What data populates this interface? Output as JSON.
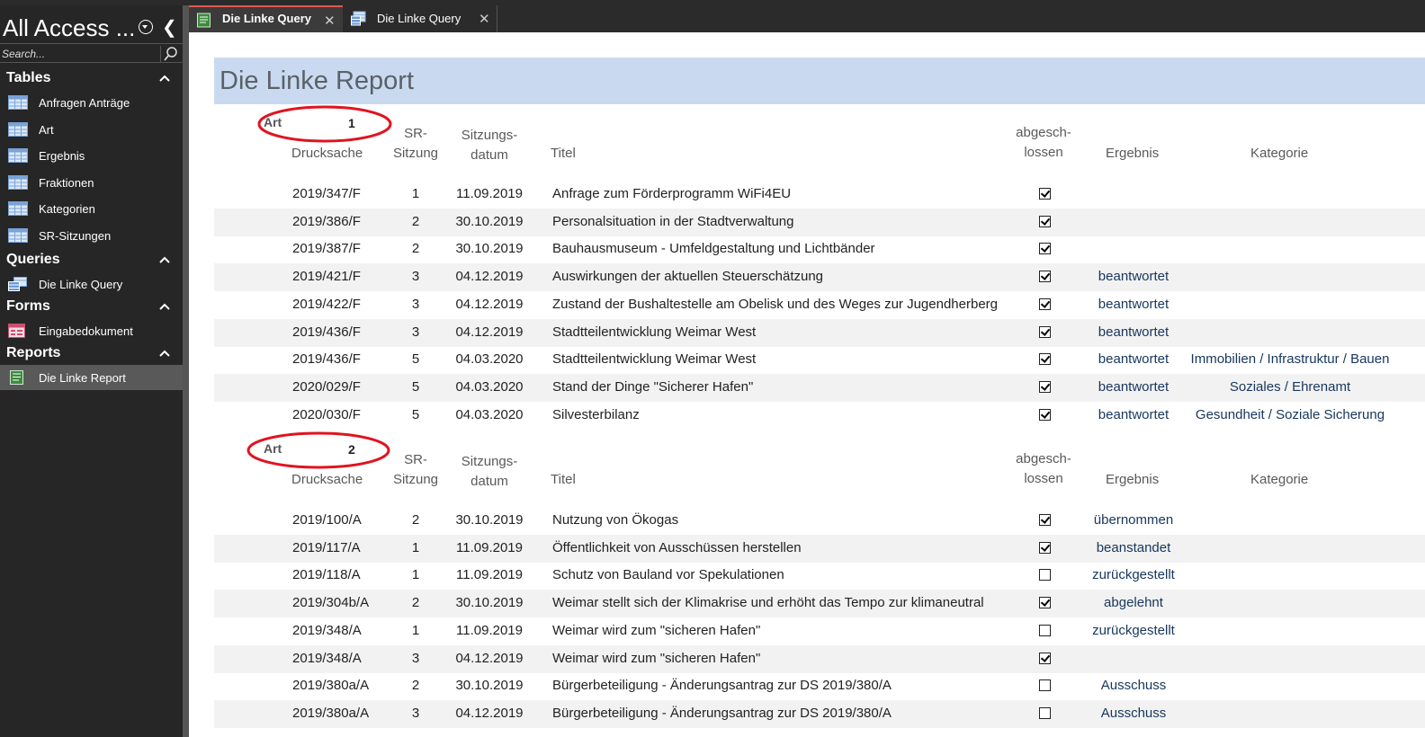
{
  "nav": {
    "title": "All Access ...",
    "search_placeholder": "Search...",
    "groups": [
      {
        "label": "Tables",
        "items": [
          "Anfragen Anträge",
          "Art",
          "Ergebnis",
          "Fraktionen",
          "Kategorien",
          "SR-Sitzungen"
        ]
      },
      {
        "label": "Queries",
        "items": [
          "Die Linke Query"
        ]
      },
      {
        "label": "Forms",
        "items": [
          "Eingabedokument"
        ]
      },
      {
        "label": "Reports",
        "items": [
          "Die Linke Report"
        ]
      }
    ],
    "selected_item": "Die Linke Report"
  },
  "tabs": [
    {
      "label": "Die Linke Query",
      "active": true,
      "icon": "report-icon"
    },
    {
      "label": "Die Linke Query",
      "active": false,
      "icon": "query-icon"
    }
  ],
  "report": {
    "title": "Die Linke Report",
    "columns": {
      "drucksache": "Drucksache",
      "sr_sitzung": [
        "SR-",
        "Sitzung"
      ],
      "sitzungsdatum": [
        "Sitzungs-",
        "datum"
      ],
      "titel": "Titel",
      "abgeschlossen": [
        "abgesch-",
        "lossen"
      ],
      "ergebnis": "Ergebnis",
      "kategorie": "Kategorie"
    },
    "groups": [
      {
        "label": "Art",
        "value": "1",
        "rows": [
          {
            "drucksache": "2019/347/F",
            "sitzung": "1",
            "datum": "11.09.2019",
            "titel": "Anfrage zum Förderprogramm WiFi4EU",
            "abgeschlossen": true,
            "ergebnis": "",
            "kategorie": ""
          },
          {
            "drucksache": "2019/386/F",
            "sitzung": "2",
            "datum": "30.10.2019",
            "titel": "Personalsituation in der Stadtverwaltung",
            "abgeschlossen": true,
            "ergebnis": "",
            "kategorie": ""
          },
          {
            "drucksache": "2019/387/F",
            "sitzung": "2",
            "datum": "30.10.2019",
            "titel": "Bauhausmuseum - Umfeldgestaltung und Lichtbänder",
            "abgeschlossen": true,
            "ergebnis": "",
            "kategorie": ""
          },
          {
            "drucksache": "2019/421/F",
            "sitzung": "3",
            "datum": "04.12.2019",
            "titel": "Auswirkungen der aktuellen Steuerschätzung",
            "abgeschlossen": true,
            "ergebnis": "beantwortet",
            "kategorie": ""
          },
          {
            "drucksache": "2019/422/F",
            "sitzung": "3",
            "datum": "04.12.2019",
            "titel": "Zustand der Bushaltestelle am Obelisk und des Weges zur Jugendherberg",
            "abgeschlossen": true,
            "ergebnis": "beantwortet",
            "kategorie": ""
          },
          {
            "drucksache": "2019/436/F",
            "sitzung": "3",
            "datum": "04.12.2019",
            "titel": "Stadtteilentwicklung Weimar West",
            "abgeschlossen": true,
            "ergebnis": "beantwortet",
            "kategorie": ""
          },
          {
            "drucksache": "2019/436/F",
            "sitzung": "5",
            "datum": "04.03.2020",
            "titel": "Stadtteilentwicklung Weimar West",
            "abgeschlossen": true,
            "ergebnis": "beantwortet",
            "kategorie": "Immobilien / Infrastruktur / Bauen"
          },
          {
            "drucksache": "2020/029/F",
            "sitzung": "5",
            "datum": "04.03.2020",
            "titel": "Stand der Dinge \"Sicherer Hafen\"",
            "abgeschlossen": true,
            "ergebnis": "beantwortet",
            "kategorie": "Soziales / Ehrenamt"
          },
          {
            "drucksache": "2020/030/F",
            "sitzung": "5",
            "datum": "04.03.2020",
            "titel": "Silvesterbilanz",
            "abgeschlossen": true,
            "ergebnis": "beantwortet",
            "kategorie": "Gesundheit / Soziale Sicherung"
          }
        ]
      },
      {
        "label": "Art",
        "value": "2",
        "rows": [
          {
            "drucksache": "2019/100/A",
            "sitzung": "2",
            "datum": "30.10.2019",
            "titel": "Nutzung von Ökogas",
            "abgeschlossen": true,
            "ergebnis": "übernommen",
            "kategorie": ""
          },
          {
            "drucksache": "2019/117/A",
            "sitzung": "1",
            "datum": "11.09.2019",
            "titel": "Öffentlichkeit von Ausschüssen herstellen",
            "abgeschlossen": true,
            "ergebnis": "beanstandet",
            "kategorie": ""
          },
          {
            "drucksache": "2019/118/A",
            "sitzung": "1",
            "datum": "11.09.2019",
            "titel": "Schutz von Bauland vor Spekulationen",
            "abgeschlossen": false,
            "ergebnis": "zurückgestellt",
            "kategorie": ""
          },
          {
            "drucksache": "2019/304b/A",
            "sitzung": "2",
            "datum": "30.10.2019",
            "titel": "Weimar stellt sich der Klimakrise und erhöht das Tempo zur klimaneutral",
            "abgeschlossen": true,
            "ergebnis": "abgelehnt",
            "kategorie": ""
          },
          {
            "drucksache": "2019/348/A",
            "sitzung": "1",
            "datum": "11.09.2019",
            "titel": "Weimar wird zum \"sicheren Hafen\"",
            "abgeschlossen": false,
            "ergebnis": "zurückgestellt",
            "kategorie": ""
          },
          {
            "drucksache": "2019/348/A",
            "sitzung": "3",
            "datum": "04.12.2019",
            "titel": "Weimar wird zum \"sicheren Hafen\"",
            "abgeschlossen": true,
            "ergebnis": "",
            "kategorie": ""
          },
          {
            "drucksache": "2019/380a/A",
            "sitzung": "2",
            "datum": "30.10.2019",
            "titel": "Bürgerbeteiligung - Änderungsantrag zur DS 2019/380/A",
            "abgeschlossen": false,
            "ergebnis": "Ausschuss",
            "kategorie": ""
          },
          {
            "drucksache": "2019/380a/A",
            "sitzung": "3",
            "datum": "04.12.2019",
            "titel": "Bürgerbeteiligung - Änderungsantrag zur DS 2019/380/A",
            "abgeschlossen": false,
            "ergebnis": "Ausschuss",
            "kategorie": ""
          }
        ]
      }
    ]
  }
}
